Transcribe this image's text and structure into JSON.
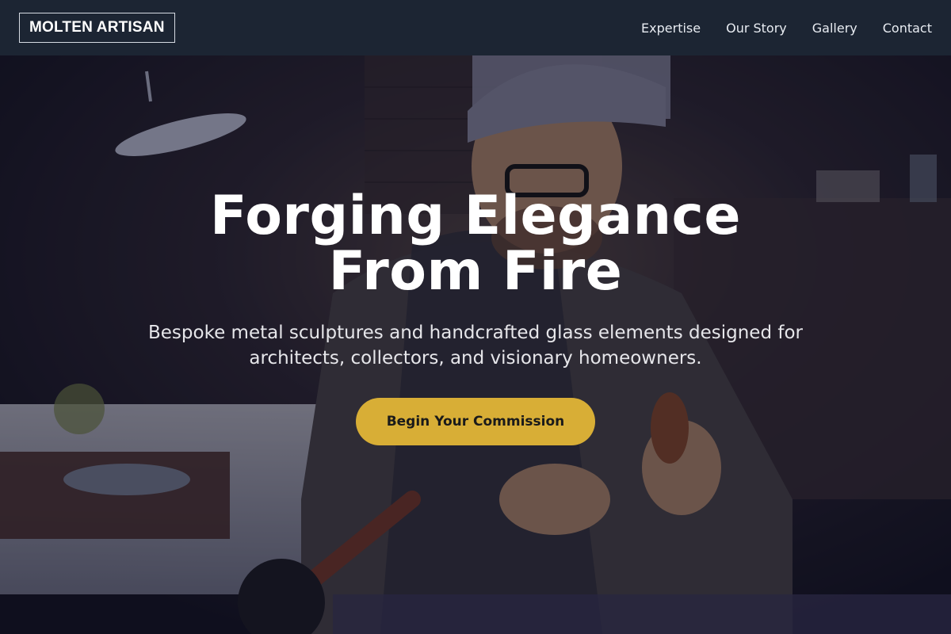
{
  "nav": {
    "logo": "MOLTEN ARTISAN",
    "links": [
      "Expertise",
      "Our Story",
      "Gallery",
      "Contact"
    ]
  },
  "hero": {
    "title_line1": "Forging Elegance",
    "title_line2": "From Fire",
    "subtitle": "Bespoke metal sculptures and handcrafted glass elements designed for architects, collectors, and visionary homeowners.",
    "cta_label": "Begin Your Commission",
    "background_description": "dark workshop photo of an artisan in cap and glasses shaping glass"
  },
  "colors": {
    "nav_bg": "#1c2533",
    "cta_bg": "#d8ae36",
    "text": "#ffffff"
  }
}
